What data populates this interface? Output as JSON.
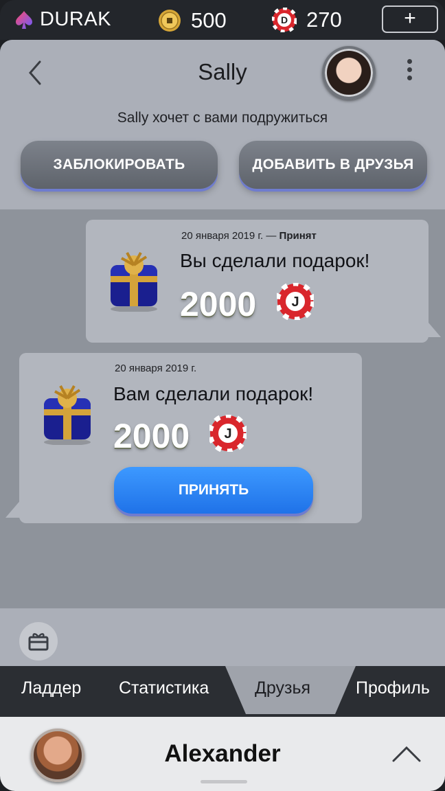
{
  "topbar": {
    "brand": "DURAK",
    "coins": "500",
    "chips": "270",
    "plus": "+"
  },
  "chat": {
    "contact_name": "Sally",
    "friend_request_text": "Sally хочет с вами подружиться",
    "block_label": "ЗАБЛОКИРОВАТЬ",
    "add_friend_label": "ДОБАВИТЬ В ДРУЗЬЯ",
    "messages": [
      {
        "date": "20 января 2019 г. — ",
        "status": "Принят",
        "title": "Вы сделали подарок!",
        "amount": "2000"
      },
      {
        "date": "20 января 2019 г.",
        "title": "Вам сделали подарок!",
        "amount": "2000",
        "action_label": "ПРИНЯТЬ"
      }
    ]
  },
  "tabs": [
    "Ладдер",
    "Статистика",
    "Друзья",
    "Профиль"
  ],
  "active_tab": "Друзья",
  "profile": {
    "name": "Alexander"
  },
  "colors": {
    "accent_blue": "#2a83f5",
    "chip_red": "#d9262c",
    "panel_gray": "#abafb8"
  }
}
